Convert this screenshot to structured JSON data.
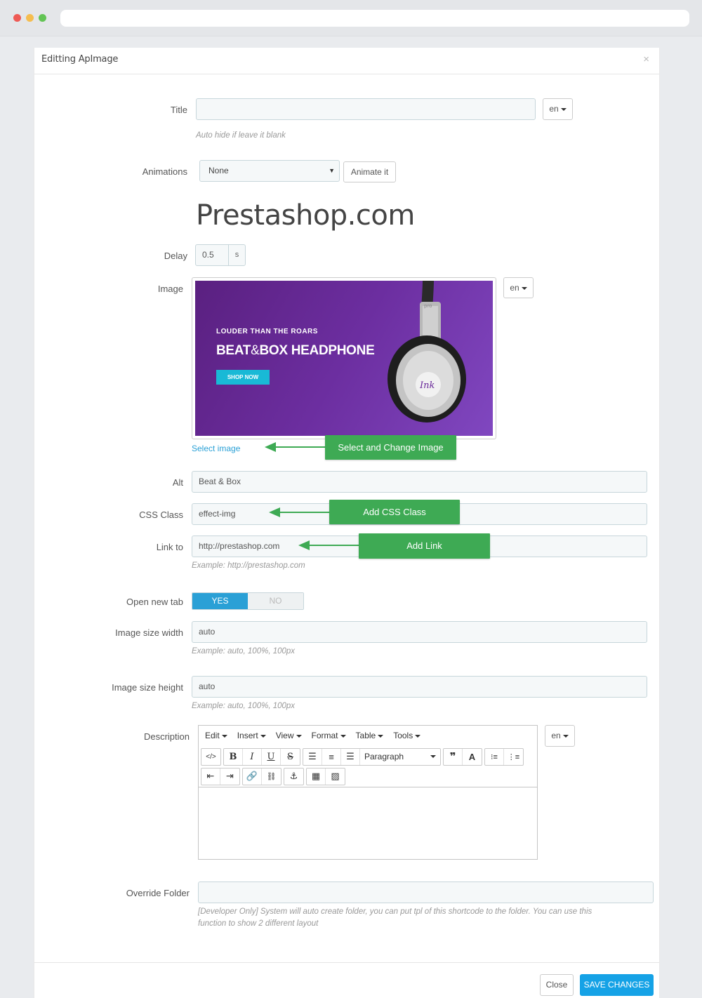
{
  "modal": {
    "title": "Editting ApImage",
    "close_glyph": "×"
  },
  "form": {
    "title": {
      "label": "Title",
      "value": "",
      "lang": "en",
      "help": "Auto hide if leave it blank"
    },
    "animations": {
      "label": "Animations",
      "selected": "None",
      "button": "Animate it",
      "preview_text": "Prestashop.com"
    },
    "delay": {
      "label": "Delay",
      "value": "0.5",
      "unit": "s"
    },
    "image": {
      "label": "Image",
      "lang": "en",
      "select_link": "Select image",
      "banner": {
        "kicker": "LOUDER THAN THE ROARS",
        "headline_a": "BEAT",
        "headline_amp": "&",
        "headline_b": "BOX HEADPHONE",
        "button": "SHOP NOW",
        "brand": "Ink",
        "model": "pro"
      }
    },
    "alt": {
      "label": "Alt",
      "value": "Beat & Box"
    },
    "css_class": {
      "label": "CSS Class",
      "value": "effect-img"
    },
    "link": {
      "label": "Link to",
      "value": "http://prestashop.com",
      "help": "Example: http://prestashop.com"
    },
    "open_new_tab": {
      "label": "Open new tab",
      "yes": "YES",
      "no": "NO",
      "value": "YES"
    },
    "width": {
      "label": "Image size width",
      "value": "auto",
      "help": "Example: auto, 100%, 100px"
    },
    "height": {
      "label": "Image size height",
      "value": "auto",
      "help": "Example: auto, 100%, 100px"
    },
    "description": {
      "label": "Description",
      "lang": "en",
      "menu": [
        "Edit",
        "Insert",
        "View",
        "Format",
        "Table",
        "Tools"
      ],
      "block_format": "Paragraph"
    },
    "override": {
      "label": "Override Folder",
      "value": "",
      "help_line1": "[Developer Only] System will auto create folder, you can put tpl of this shortcode to the folder. You can use this",
      "help_line2": "function to show 2 different layout"
    }
  },
  "annotations": {
    "select_image": "Select and Change Image",
    "css": "Add CSS Class",
    "link": "Add Link"
  },
  "footer": {
    "close": "Close",
    "save": "SAVE CHANGES"
  },
  "colors": {
    "accent": "#2aa0d6",
    "save": "#15a2e6",
    "annotation": "#3eaa54",
    "banner": "#6c2ea0"
  }
}
